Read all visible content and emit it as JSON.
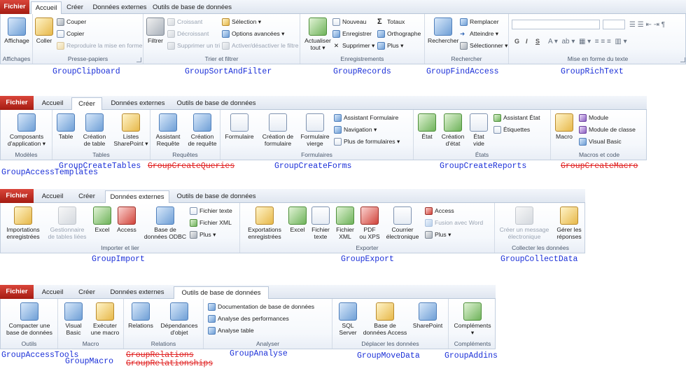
{
  "ribbons": [
    {
      "tabs": [
        "Fichier",
        "Accueil",
        "Créer",
        "Données externes",
        "Outils de base de données"
      ],
      "active_tab": "Accueil",
      "groups": {
        "affichages": {
          "caption": "Affichages",
          "button": "Affichage"
        },
        "presse": {
          "caption": "Presse-papiers",
          "paste": "Coller",
          "cut": "Couper",
          "copy": "Copier",
          "format": "Reproduire la mise en forme"
        },
        "trier": {
          "caption": "Trier et filtrer",
          "filter": "Filtrer",
          "asc": "Croissant",
          "desc": "Décroissant",
          "remove": "Supprimer un tri",
          "selection": "Sélection",
          "advanced": "Options avancées",
          "toggle": "Activer/désactiver le filtre"
        },
        "enreg": {
          "caption": "Enregistrements",
          "refresh1": "Actualiser",
          "refresh2": "tout",
          "new": "Nouveau",
          "save": "Enregistrer",
          "delete": "Supprimer",
          "totals": "Totaux",
          "spelling": "Orthographe",
          "more": "Plus"
        },
        "recherch": {
          "caption": "Rechercher",
          "find": "Rechercher",
          "replace": "Remplacer",
          "goto": "Atteindre",
          "select": "Sélectionner"
        },
        "miseforme": {
          "caption": "Mise en forme du texte",
          "bold": "G",
          "italic": "I",
          "underline": "S"
        }
      }
    },
    {
      "tabs": [
        "Fichier",
        "Accueil",
        "Créer",
        "Données externes",
        "Outils de base de données"
      ],
      "active_tab": "Créer",
      "groups": {
        "modeles": {
          "caption": "Modèles",
          "b1": "Composants",
          "b2": "d'application"
        },
        "tables": {
          "caption": "Tables",
          "table": "Table",
          "design1": "Création",
          "design2": "de table",
          "sp1": "Listes",
          "sp2": "SharePoint"
        },
        "requetes": {
          "caption": "Requêtes",
          "wiz1": "Assistant",
          "wiz2": "Requête",
          "des1": "Création",
          "des2": "de requête"
        },
        "formulaires": {
          "caption": "Formulaires",
          "form": "Formulaire",
          "fd1": "Création de",
          "fd2": "formulaire",
          "blank1": "Formulaire",
          "blank2": "vierge",
          "wizard": "Assistant Formulaire",
          "nav": "Navigation",
          "more": "Plus de formulaires"
        },
        "etats": {
          "caption": "États",
          "report": "État",
          "rd1": "Création",
          "rd2": "d'état",
          "blank1": "État",
          "blank2": "vide",
          "wizard": "Assistant État",
          "labels": "Étiquettes"
        },
        "macros": {
          "caption": "Macros et code",
          "macro": "Macro",
          "module": "Module",
          "classmod": "Module de classe",
          "vb": "Visual Basic"
        }
      }
    },
    {
      "tabs": [
        "Fichier",
        "Accueil",
        "Créer",
        "Données externes",
        "Outils de base de données"
      ],
      "active_tab": "Données externes",
      "groups": {
        "importer": {
          "caption": "Importer et lier",
          "saved1": "Importations",
          "saved2": "enregistrées",
          "mgr1": "Gestionnaire",
          "mgr2": "de tables liées",
          "excel": "Excel",
          "access": "Access",
          "odbc1": "Base de",
          "odbc2": "données ODBC",
          "text": "Fichier texte",
          "xml": "Fichier XML",
          "more": "Plus"
        },
        "exporter": {
          "caption": "Exporter",
          "saved1": "Exportations",
          "saved2": "enregistrées",
          "excel": "Excel",
          "text1": "Fichier",
          "text2": "texte",
          "xml1": "Fichier",
          "xml2": "XML",
          "pdf1": "PDF",
          "pdf2": "ou XPS",
          "mail1": "Courrier",
          "mail2": "électronique",
          "access": "Access",
          "word": "Fusion avec Word",
          "more": "Plus"
        },
        "collecter": {
          "caption": "Collecter les données",
          "create1": "Créer un message",
          "create2": "électronique",
          "manage1": "Gérer les",
          "manage2": "réponses"
        }
      }
    },
    {
      "tabs": [
        "Fichier",
        "Accueil",
        "Créer",
        "Données externes",
        "Outils de base de données"
      ],
      "active_tab": "Outils de base de données",
      "groups": {
        "outils": {
          "caption": "Outils",
          "b1": "Compacter une",
          "b2": "base de données"
        },
        "macro": {
          "caption": "Macro",
          "vb1": "Visual",
          "vb2": "Basic",
          "run1": "Exécuter",
          "run2": "une macro"
        },
        "relations": {
          "caption": "Relations",
          "rel": "Relations",
          "dep1": "Dépendances",
          "dep2": "d'objet"
        },
        "analyser": {
          "caption": "Analyser",
          "doc": "Documentation de base de données",
          "perf": "Analyse des performances",
          "table": "Analyse table"
        },
        "deplacer": {
          "caption": "Déplacer les données",
          "sql1": "SQL",
          "sql2": "Server",
          "db1": "Base de",
          "db2": "données Access",
          "sp": "SharePoint"
        },
        "complements": {
          "caption": "Compléments",
          "addins": "Compléments"
        }
      }
    }
  ],
  "annotations": {
    "clipboard": "GroupClipboard",
    "sortfilter": "GroupSortAndFilter",
    "records": "GroupRecords",
    "findaccess": "GroupFindAccess",
    "richtext": "GroupRichText",
    "templates": "GroupAccessTemplates",
    "createtables": "GroupCreateTables",
    "createqueries": "GroupCreateQueries",
    "createforms": "GroupCreateForms",
    "createreports": "GroupCreateReports",
    "createmacro": "GroupCreateMacro",
    "import": "GroupImport",
    "export": "GroupExport",
    "collectdata": "GroupCollectData",
    "accesstools": "GroupAccessTools",
    "macro": "GroupMacro",
    "relations": "GroupRelations",
    "relationships": "GroupRelationships",
    "analyse": "GroupAnalyse",
    "movedata": "GroupMoveData",
    "addins": "GroupAddins"
  }
}
